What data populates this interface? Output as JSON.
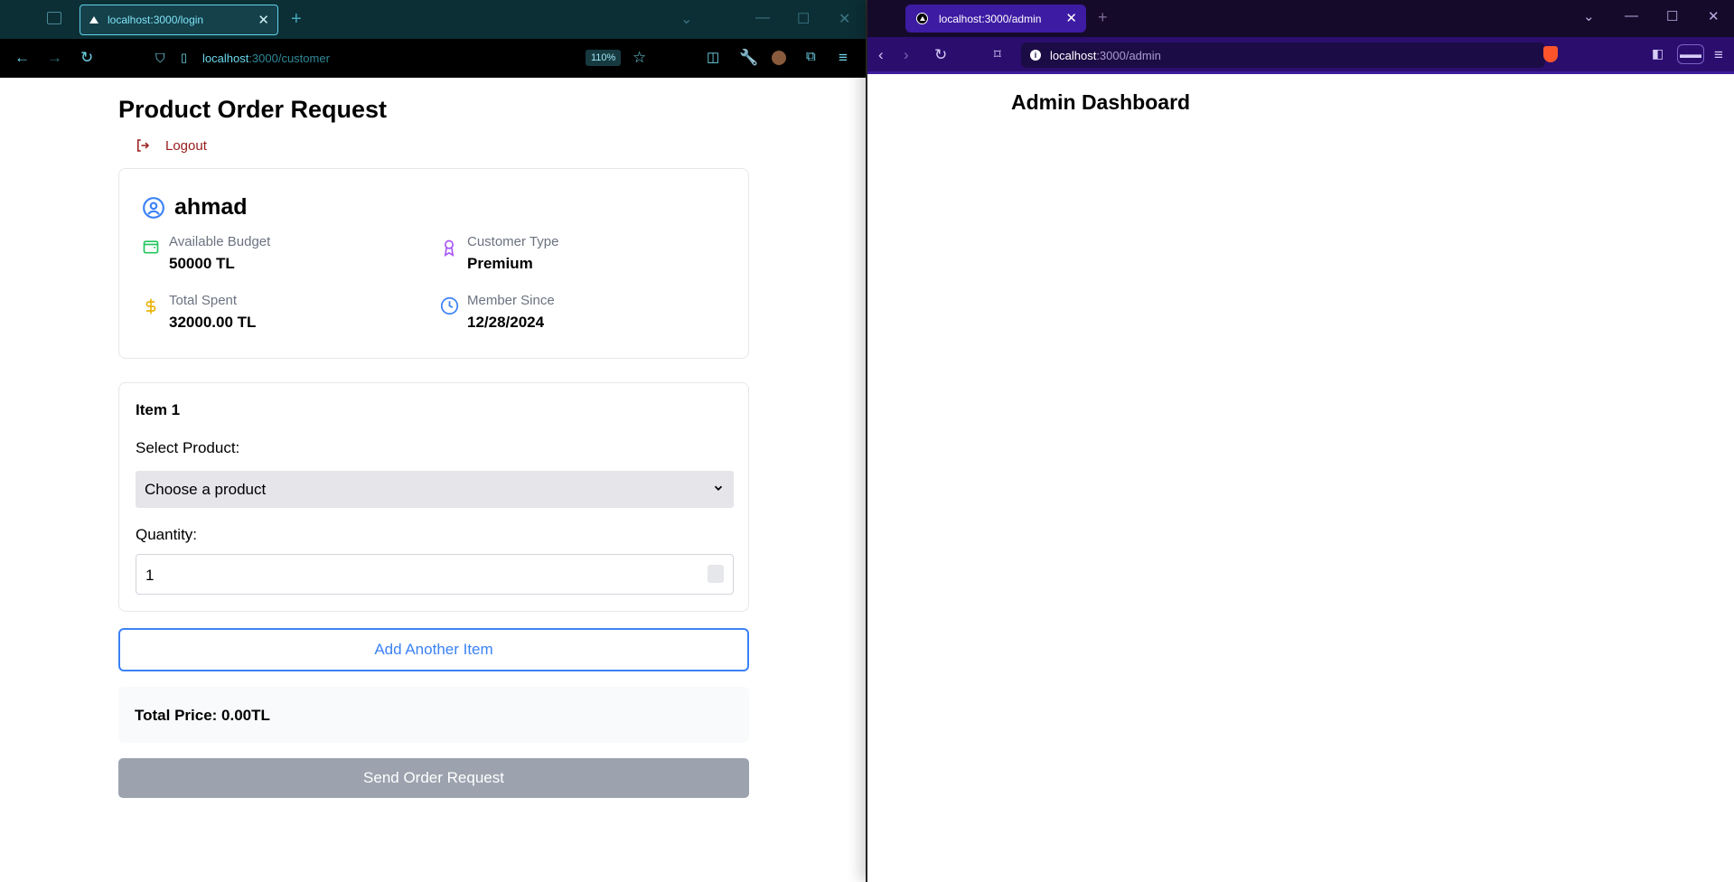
{
  "left_browser": {
    "tab_title": "localhost:3000/login",
    "url_host": "localhost",
    "url_path": ":3000/customer",
    "zoom": "110%"
  },
  "customer_page": {
    "title": "Product Order Request",
    "logout_label": "Logout",
    "user": {
      "name": "ahmad",
      "budget_label": "Available Budget",
      "budget_value": "50000 TL",
      "type_label": "Customer Type",
      "type_value": "Premium",
      "spent_label": "Total Spent",
      "spent_value": "32000.00 TL",
      "since_label": "Member Since",
      "since_value": "12/28/2024"
    },
    "item": {
      "heading": "Item 1",
      "product_label": "Select Product:",
      "product_value": "Choose a product",
      "quantity_label": "Quantity:",
      "quantity_value": "1"
    },
    "add_item_label": "Add Another Item",
    "total_label": "Total Price: 0.00TL",
    "send_label": "Send Order Request"
  },
  "right_browser": {
    "tab_title": "localhost:3000/admin",
    "url_host": "localhost",
    "url_path": ":3000/admin"
  },
  "admin_page": {
    "title": "Admin Dashboard"
  },
  "colors": {
    "ff_tabbar": "#0c2f36",
    "brave_toolbar": "#2b0d6e",
    "accent_blue": "#3b82f6",
    "logout_red": "#991b1b",
    "disabled_gray": "#9ca3af"
  },
  "icons": [
    "user-circle-icon",
    "wallet-icon",
    "award-icon",
    "dollar-icon",
    "clock-icon",
    "logout-icon",
    "chevron-down-icon"
  ]
}
